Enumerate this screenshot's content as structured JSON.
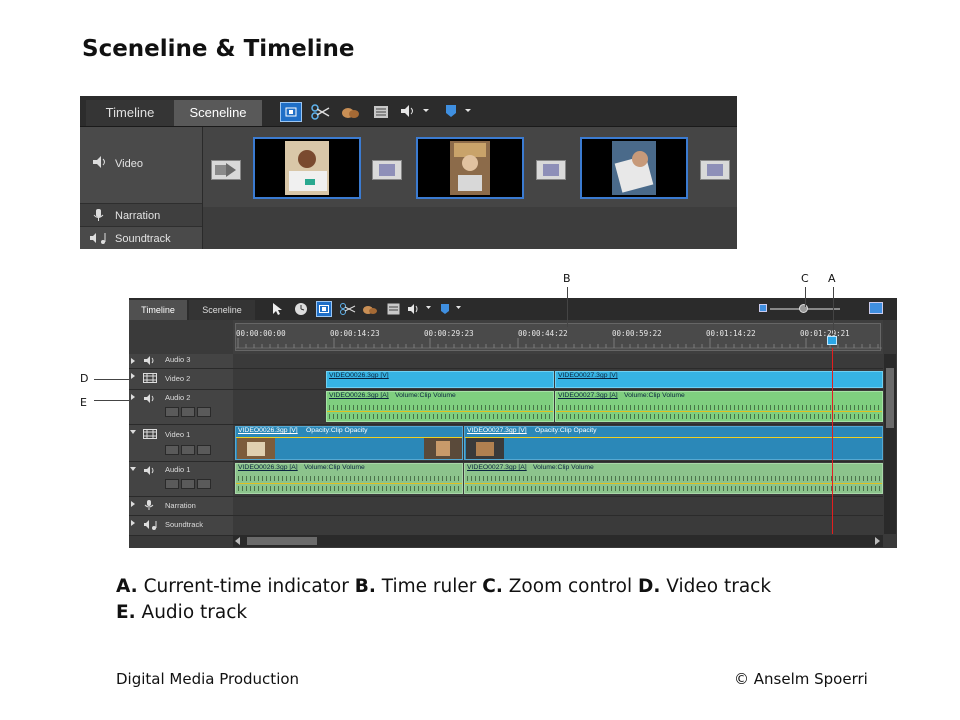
{
  "slide": {
    "title": "Sceneline & Timeline",
    "caption": [
      {
        "letter": "A.",
        "text": " Current-time indicator "
      },
      {
        "letter": "B.",
        "text": " Time ruler "
      },
      {
        "letter": "C.",
        "text": " Zoom control "
      },
      {
        "letter": "D.",
        "text": " Video track"
      },
      {
        "letter": "E.",
        "text": " Audio track"
      }
    ],
    "footer_left": "Digital Media Production",
    "footer_right": "© Anselm Spoerri"
  },
  "callouts": {
    "a": "A",
    "b": "B",
    "c": "C",
    "d": "D",
    "e": "E"
  },
  "sceneline": {
    "tabs": [
      "Timeline",
      "Sceneline"
    ],
    "active_tab": "Sceneline",
    "rows": {
      "video": "Video",
      "narration": "Narration",
      "soundtrack": "Soundtrack"
    }
  },
  "timeline": {
    "tabs": [
      "Timeline",
      "Sceneline"
    ],
    "active_tab": "Timeline",
    "ruler_labels": [
      "00:00:00:00",
      "00:00:14:23",
      "00:00:29:23",
      "00:00:44:22",
      "00:00:59:22",
      "00:01:14:22",
      "00:01:29:21"
    ],
    "tracks": {
      "audio3": "Audio 3",
      "video2": "Video 2",
      "audio2": "Audio 2",
      "video1": "Video 1",
      "audio1": "Audio 1",
      "narration": "Narration",
      "soundtrack": "Soundtrack"
    },
    "clips": {
      "v2_a": "VIDEO0026.3gp [V]",
      "v2_b": "VIDEO0027.3gp [V]",
      "a2_a_name": "VIDEO0026.3gp [A]",
      "a2_a_fx": "Volume:Clip Volume",
      "a2_b_name": "VIDEO0027.3gp [A]",
      "a2_b_fx": "Volume:Clip Volume",
      "v1_a_name": "VIDEO0026.3gp [V]",
      "v1_a_fx": "Opacity:Clip Opacity",
      "v1_b_name": "VIDEO0027.3gp [V]",
      "v1_b_fx": "Opacity:Clip Opacity",
      "a1_a_name": "VIDEO0026.3gp [A]",
      "a1_a_fx": "Volume:Clip Volume",
      "a1_b_name": "VIDEO0027.3gp [A]",
      "a1_b_fx": "Volume:Clip Volume"
    }
  },
  "colors": {
    "selected_scene_border": "#3b7bd1",
    "video_clip_track2": "#36b3e3",
    "video_clip_track1": "#2b88b8",
    "audio_clip": "#7fcf7f",
    "cti": "#e21f1f"
  }
}
